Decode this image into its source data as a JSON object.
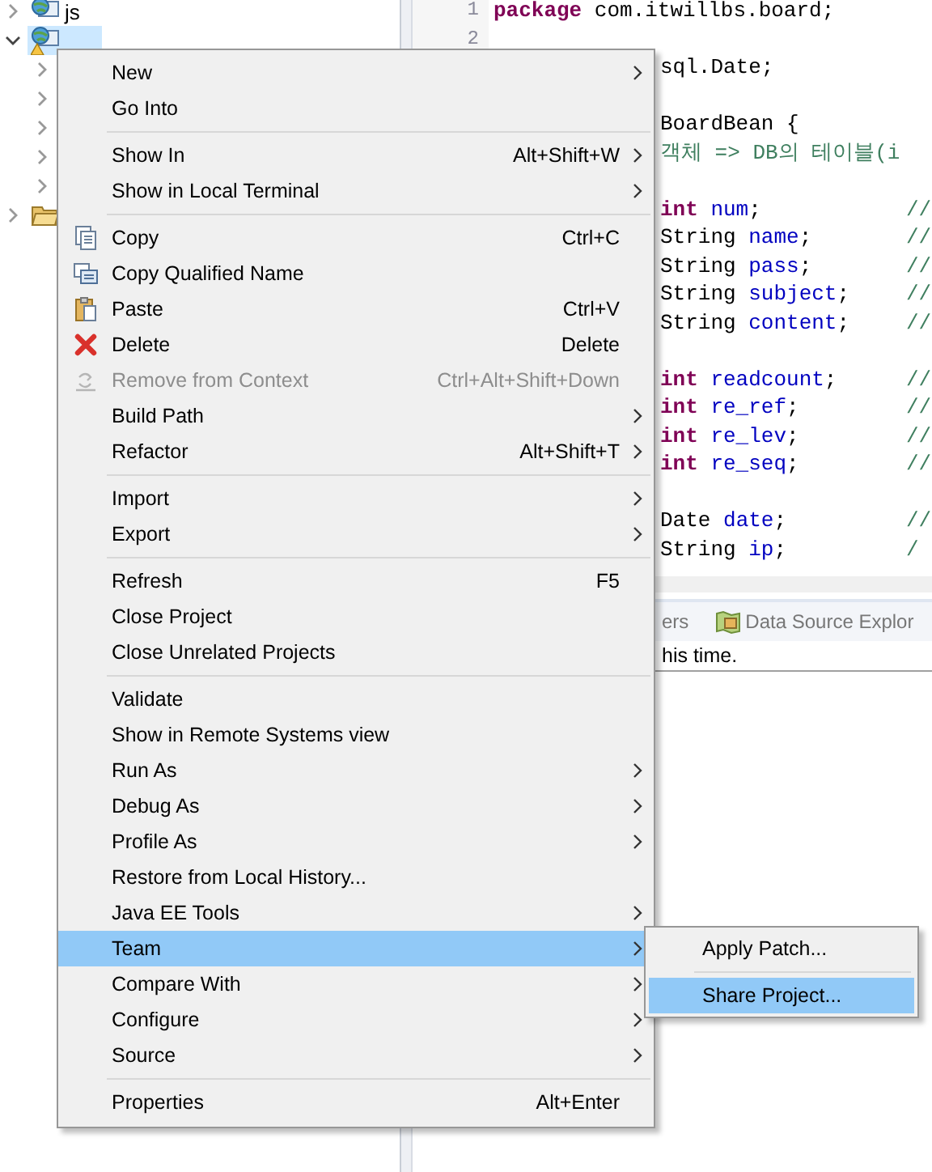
{
  "project_tree": {
    "items": [
      {
        "kind": "project",
        "label": "js",
        "expanded": false,
        "selected": false,
        "warning": false
      },
      {
        "kind": "project",
        "expanded": true,
        "selected": true,
        "warning": true,
        "children": [
          {
            "expanded": false
          },
          {
            "expanded": false
          },
          {
            "expanded": false
          },
          {
            "expanded": false
          },
          {
            "expanded": false
          }
        ]
      },
      {
        "kind": "folder",
        "expanded": false,
        "selected": false
      }
    ]
  },
  "editor": {
    "lines": [
      {
        "kind": "code",
        "number": "1",
        "tokens": [
          {
            "kind": "keyword",
            "text": "package"
          },
          {
            "kind": "plain",
            "text": " com.itwillbs.board;"
          }
        ]
      },
      {
        "kind": "code",
        "number": "2"
      },
      {
        "kind": "code",
        "tokens": [
          {
            "kind": "plain",
            "text": "sql.Date;"
          }
        ]
      },
      {
        "kind": "blank"
      },
      {
        "kind": "code",
        "tokens": [
          {
            "kind": "plain",
            "text": "BoardBean {"
          }
        ]
      },
      {
        "kind": "code",
        "tokens": [
          {
            "kind": "comment",
            "text": "객체 => DB의 테이블(i"
          }
        ]
      },
      {
        "kind": "blank"
      },
      {
        "kind": "code",
        "tokens": [
          {
            "kind": "keyword",
            "text": "int"
          },
          {
            "kind": "field",
            "text": " num"
          },
          {
            "kind": "plain",
            "text": ";"
          }
        ],
        "comment": "//"
      },
      {
        "kind": "code",
        "tokens": [
          {
            "kind": "plain",
            "text": "String"
          },
          {
            "kind": "field",
            "text": " name"
          },
          {
            "kind": "plain",
            "text": ";"
          }
        ],
        "comment": "//"
      },
      {
        "kind": "code",
        "tokens": [
          {
            "kind": "plain",
            "text": "String"
          },
          {
            "kind": "field",
            "text": " pass"
          },
          {
            "kind": "plain",
            "text": ";"
          }
        ],
        "comment": "//"
      },
      {
        "kind": "code",
        "tokens": [
          {
            "kind": "plain",
            "text": "String"
          },
          {
            "kind": "field",
            "text": " subject"
          },
          {
            "kind": "plain",
            "text": ";"
          }
        ],
        "comment": "//"
      },
      {
        "kind": "code",
        "tokens": [
          {
            "kind": "plain",
            "text": "String"
          },
          {
            "kind": "field",
            "text": " content"
          },
          {
            "kind": "plain",
            "text": ";"
          }
        ],
        "comment": "//"
      },
      {
        "kind": "blank"
      },
      {
        "kind": "code",
        "tokens": [
          {
            "kind": "keyword",
            "text": "int"
          },
          {
            "kind": "field",
            "text": " readcount"
          },
          {
            "kind": "plain",
            "text": ";"
          }
        ],
        "comment": "//"
      },
      {
        "kind": "code",
        "tokens": [
          {
            "kind": "keyword",
            "text": "int"
          },
          {
            "kind": "field",
            "text": " re_ref"
          },
          {
            "kind": "plain",
            "text": ";"
          }
        ],
        "comment": "//"
      },
      {
        "kind": "code",
        "tokens": [
          {
            "kind": "keyword",
            "text": "int"
          },
          {
            "kind": "field",
            "text": " re_lev"
          },
          {
            "kind": "plain",
            "text": ";"
          }
        ],
        "comment": "//"
      },
      {
        "kind": "code",
        "tokens": [
          {
            "kind": "keyword",
            "text": "int"
          },
          {
            "kind": "field",
            "text": " re_seq"
          },
          {
            "kind": "plain",
            "text": ";"
          }
        ],
        "comment": "//"
      },
      {
        "kind": "blank"
      },
      {
        "kind": "code",
        "tokens": [
          {
            "kind": "plain",
            "text": "Date"
          },
          {
            "kind": "field",
            "text": " date"
          },
          {
            "kind": "plain",
            "text": ";"
          }
        ],
        "comment": "//"
      },
      {
        "kind": "code",
        "tokens": [
          {
            "kind": "plain",
            "text": "String"
          },
          {
            "kind": "field",
            "text": " ip"
          },
          {
            "kind": "plain",
            "text": ";"
          }
        ],
        "comment": "/"
      }
    ]
  },
  "bottom_panel": {
    "tabs": [
      {
        "kind": "plain",
        "label": "ers"
      },
      {
        "kind": "datasource",
        "label": "Data Source Explor"
      }
    ],
    "message": "his time."
  },
  "context_menu": {
    "items": [
      {
        "kind": "item",
        "label": "New",
        "submenu": true
      },
      {
        "kind": "item",
        "label": "Go Into"
      },
      {
        "kind": "separator"
      },
      {
        "kind": "item",
        "label": "Show In",
        "shortcut": "Alt+Shift+W",
        "submenu": true
      },
      {
        "kind": "item",
        "label": "Show in Local Terminal",
        "submenu": true
      },
      {
        "kind": "separator"
      },
      {
        "kind": "copy",
        "label": "Copy",
        "shortcut": "Ctrl+C"
      },
      {
        "kind": "qualified",
        "label": "Copy Qualified Name"
      },
      {
        "kind": "paste",
        "label": "Paste",
        "shortcut": "Ctrl+V"
      },
      {
        "kind": "delete",
        "label": "Delete",
        "shortcut": "Delete"
      },
      {
        "kind": "remove",
        "label": "Remove from Context",
        "shortcut": "Ctrl+Alt+Shift+Down",
        "disabled": true
      },
      {
        "kind": "item",
        "label": "Build Path",
        "submenu": true
      },
      {
        "kind": "item",
        "label": "Refactor",
        "shortcut": "Alt+Shift+T",
        "submenu": true
      },
      {
        "kind": "separator"
      },
      {
        "kind": "item",
        "label": "Import",
        "submenu": true
      },
      {
        "kind": "item",
        "label": "Export",
        "submenu": true
      },
      {
        "kind": "separator"
      },
      {
        "kind": "item",
        "label": "Refresh",
        "shortcut": "F5"
      },
      {
        "kind": "item",
        "label": "Close Project"
      },
      {
        "kind": "item",
        "label": "Close Unrelated Projects"
      },
      {
        "kind": "separator"
      },
      {
        "kind": "item",
        "label": "Validate"
      },
      {
        "kind": "item",
        "label": "Show in Remote Systems view"
      },
      {
        "kind": "item",
        "label": "Run As",
        "submenu": true
      },
      {
        "kind": "item",
        "label": "Debug As",
        "submenu": true
      },
      {
        "kind": "item",
        "label": "Profile As",
        "submenu": true
      },
      {
        "kind": "item",
        "label": "Restore from Local History..."
      },
      {
        "kind": "item",
        "label": "Java EE Tools",
        "submenu": true
      },
      {
        "kind": "item",
        "label": "Team",
        "submenu": true,
        "selected": true
      },
      {
        "kind": "item",
        "label": "Compare With",
        "submenu": true
      },
      {
        "kind": "item",
        "label": "Configure",
        "submenu": true
      },
      {
        "kind": "item",
        "label": "Source",
        "submenu": true
      },
      {
        "kind": "separator"
      },
      {
        "kind": "item",
        "label": "Properties",
        "shortcut": "Alt+Enter"
      }
    ]
  },
  "submenu": {
    "items": [
      {
        "kind": "item",
        "label": "Apply Patch...",
        "selected": false
      },
      {
        "kind": "separator"
      },
      {
        "kind": "item",
        "label": "Share Project...",
        "selected": true
      }
    ]
  }
}
